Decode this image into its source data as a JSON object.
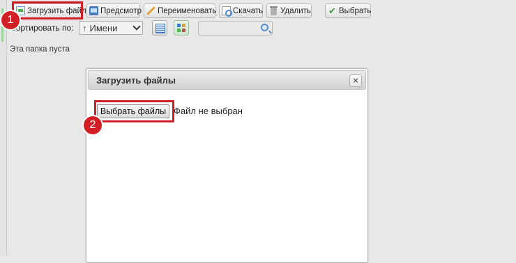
{
  "toolbar": {
    "upload_label": "Загрузить файл",
    "preview_label": "Предсмотр",
    "rename_label": "Переименовать",
    "download_label": "Скачать",
    "delete_label": "Удалить",
    "select_label": "Выбрать"
  },
  "sort": {
    "label": "Сортировать по:",
    "selected_value": "Имени"
  },
  "folder": {
    "empty_text": "Эта папка пуста"
  },
  "dialog": {
    "title": "Загрузить файлы",
    "choose_files_label": "Выбрать файлы",
    "file_status": "Файл не выбран",
    "close_label": "×"
  },
  "annotations": {
    "marker1": "1",
    "marker2": "2",
    "highlight_color": "#d21f26"
  },
  "icons": [
    "upload-icon",
    "preview-icon",
    "rename-icon",
    "download-icon",
    "delete-icon",
    "check-icon",
    "list-view-icon",
    "grid-view-icon",
    "search-icon",
    "close-icon"
  ]
}
